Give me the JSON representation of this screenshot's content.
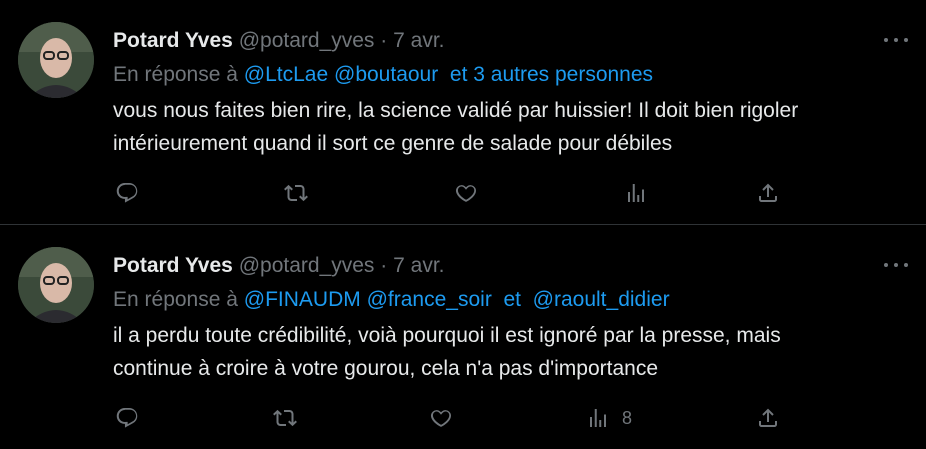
{
  "tweets": [
    {
      "author_name": "Potard Yves",
      "author_handle": "@potard_yves",
      "separator": "·",
      "date": "7 avr.",
      "reply_prefix": "En réponse à",
      "reply_mentions": [
        "@LtcLae",
        "@boutaour",
        "et 3 autres personnes"
      ],
      "text_lines": [
        "vous nous faites bien rire, la science validé par huissier! Il doit bien rigoler",
        "intérieurement quand il sort ce genre de salade pour débiles"
      ],
      "views_count": ""
    },
    {
      "author_name": "Potard Yves",
      "author_handle": "@potard_yves",
      "separator": "·",
      "date": "7 avr.",
      "reply_prefix": "En réponse à",
      "reply_mentions": [
        "@FINAUDM",
        "@france_soir",
        "et",
        "@raoult_didier"
      ],
      "text_lines": [
        "il a perdu toute crédibilité, voià pourquoi il est ignoré par la presse, mais",
        "continue à croire à votre gourou, cela n'a pas d'importance"
      ],
      "views_count": "8"
    }
  ],
  "icons": {
    "more": "more-dots-icon",
    "reply": "reply-icon",
    "retweet": "retweet-icon",
    "like": "like-icon",
    "views": "views-icon",
    "share": "share-icon"
  },
  "colors": {
    "background": "#000000",
    "text": "#e7e9ea",
    "muted": "#71767b",
    "link": "#1d9bf0",
    "divider": "#2f3336"
  }
}
